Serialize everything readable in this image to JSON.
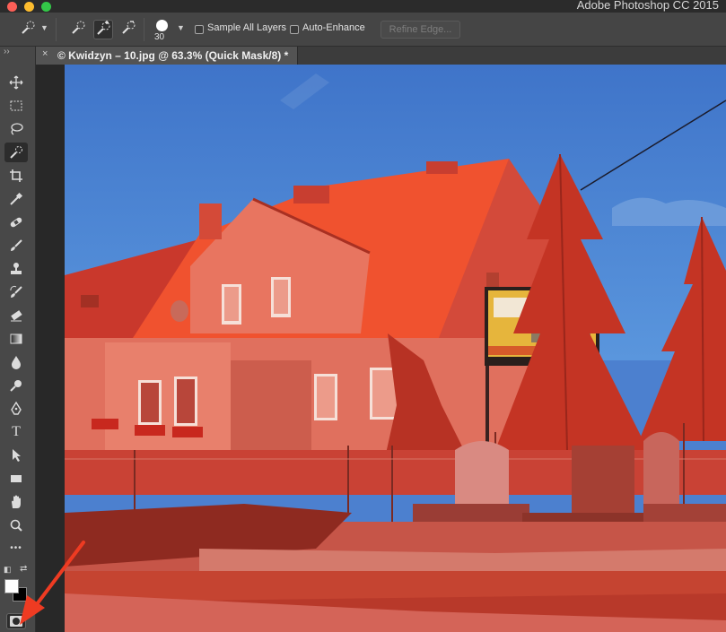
{
  "window": {
    "app_title": "Adobe Photoshop CC 2015"
  },
  "options_bar": {
    "tool_preset_icon": "quick-selection-icon",
    "mode_icons": [
      "new-selection-icon",
      "add-to-selection-icon",
      "subtract-from-selection-icon"
    ],
    "brush_size": "30",
    "sample_all_layers": {
      "label": "Sample All Layers",
      "checked": false
    },
    "auto_enhance": {
      "label": "Auto-Enhance",
      "checked": false
    },
    "refine_edge_label": "Refine Edge..."
  },
  "document_tab": {
    "close_glyph": "×",
    "title": "© Kwidzyn – 10.jpg @ 63.3% (Quick Mask/8) *"
  },
  "toolbar": {
    "collapse_glyph": "››",
    "tools": [
      "move-tool",
      "rectangular-marquee-tool",
      "lasso-tool",
      "quick-selection-tool",
      "crop-tool",
      "eyedropper-tool",
      "healing-brush-tool",
      "brush-tool",
      "clone-stamp-tool",
      "history-brush-tool",
      "eraser-tool",
      "gradient-tool",
      "blur-tool",
      "dodge-tool",
      "pen-tool",
      "type-tool",
      "path-selection-tool",
      "rectangle-tool",
      "hand-tool",
      "zoom-tool",
      "more-tools"
    ],
    "type_glyph": "T",
    "more_glyph": "•••",
    "foreground_color": "#ffffff",
    "background_color": "#000000",
    "quick_mask_active": true
  },
  "colors": {
    "mask_overlay": "#ff2a1e",
    "sky": "#4c80cf",
    "annotation_arrow": "#ee3b22"
  }
}
